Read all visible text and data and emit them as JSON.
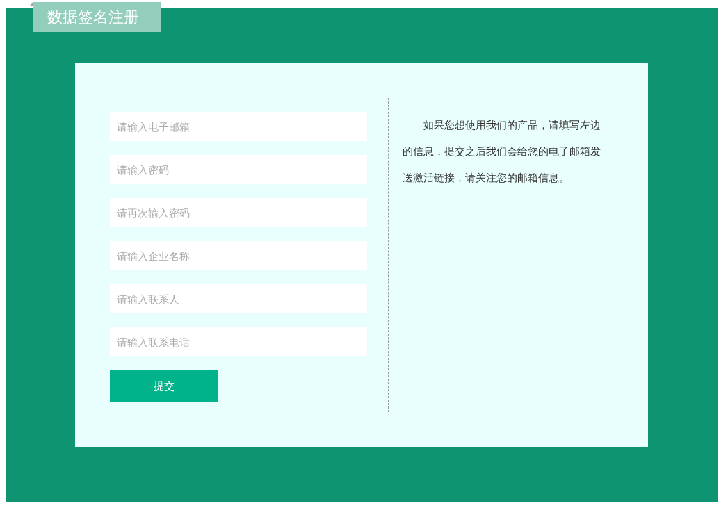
{
  "title": "数据签名注册",
  "fields": [
    {
      "placeholder": "请输入电子邮箱"
    },
    {
      "placeholder": "请输入密码"
    },
    {
      "placeholder": "请再次输入密码"
    },
    {
      "placeholder": "请输入企业名称"
    },
    {
      "placeholder": "请输入联系人"
    },
    {
      "placeholder": "请输入联系电话"
    }
  ],
  "submit_button": "提交",
  "notice": "如果您想使用我们的产品，请填写左边的信息，提交之后我们会给您的电子邮箱发送激活链接，请关注您的邮箱信息。"
}
